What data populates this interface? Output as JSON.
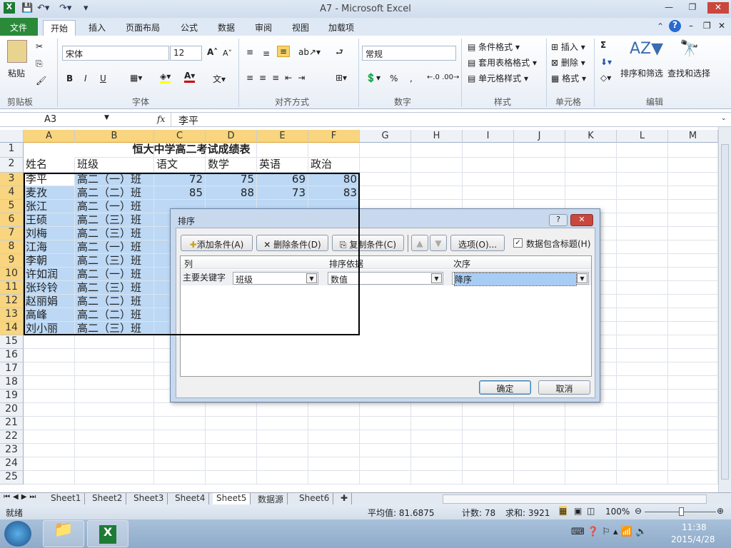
{
  "window": {
    "title": "A7  -  Microsoft Excel"
  },
  "tabs": [
    "文件",
    "开始",
    "插入",
    "页面布局",
    "公式",
    "数据",
    "审阅",
    "视图",
    "加载项"
  ],
  "ribbon": {
    "clipboard": {
      "paste": "粘贴",
      "group": "剪贴板"
    },
    "font": {
      "name": "宋体",
      "size": "12",
      "group": "字体",
      "bold": "B",
      "italic": "I",
      "underline": "U"
    },
    "alignment": {
      "group": "对齐方式"
    },
    "number": {
      "format": "常规",
      "group": "数字",
      "percent": "%",
      "comma": ","
    },
    "styles": {
      "conditional": "条件格式",
      "table": "套用表格格式",
      "cell": "单元格样式",
      "group": "样式"
    },
    "cells": {
      "insert": "插入",
      "delete": "删除",
      "format": "格式",
      "group": "单元格"
    },
    "editing": {
      "sort": "排序和筛选",
      "find": "查找和选择",
      "group": "编辑",
      "sum": "Σ"
    }
  },
  "formula_bar": {
    "name_box": "A3",
    "fx": "fx",
    "value": "李平"
  },
  "columns": [
    "A",
    "B",
    "C",
    "D",
    "E",
    "F",
    "G",
    "H",
    "I",
    "J",
    "K",
    "L",
    "M"
  ],
  "sheet": {
    "title": "恒大中学高二考试成绩表",
    "headers": [
      "姓名",
      "班级",
      "语文",
      "数学",
      "英语",
      "政治"
    ],
    "rows": [
      [
        "李平",
        "高二（一）班",
        "72",
        "75",
        "69",
        "80"
      ],
      [
        "麦孜",
        "高二（二）班",
        "85",
        "88",
        "73",
        "83"
      ],
      [
        "张江",
        "高二（一）班"
      ],
      [
        "王硕",
        "高二（三）班"
      ],
      [
        "刘梅",
        "高二（三）班"
      ],
      [
        "江海",
        "高二（一）班"
      ],
      [
        "李朝",
        "高二（三）班"
      ],
      [
        "许如润",
        "高二（一）班"
      ],
      [
        "张玲铃",
        "高二（三）班"
      ],
      [
        "赵丽娟",
        "高二（二）班"
      ],
      [
        "高峰",
        "高二（二）班"
      ],
      [
        "刘小丽",
        "高二（三）班"
      ]
    ],
    "row_count": 25
  },
  "sheet_tabs": [
    "Sheet1",
    "Sheet2",
    "Sheet3",
    "Sheet4",
    "Sheet5",
    "数据源",
    "Sheet6"
  ],
  "active_sheet": "Sheet5",
  "status": {
    "ready": "就绪",
    "average": "平均值: 81.6875",
    "count": "计数: 78",
    "sum": "求和: 3921",
    "zoom": "100%"
  },
  "taskbar": {
    "time": "11:38",
    "date": "2015/4/28"
  },
  "dialog": {
    "title": "排序",
    "add": "添加条件(A)",
    "delete": "删除条件(D)",
    "copy": "复制条件(C)",
    "options": "选项(O)...",
    "has_header": "数据包含标题(H)",
    "has_header_checked": true,
    "col_header": "列",
    "sort_on_header": "排序依据",
    "order_header": "次序",
    "row_label": "主要关键字",
    "column_value": "班级",
    "sort_on_value": "数值",
    "order_value": "降序",
    "ok": "确定",
    "cancel": "取消"
  }
}
